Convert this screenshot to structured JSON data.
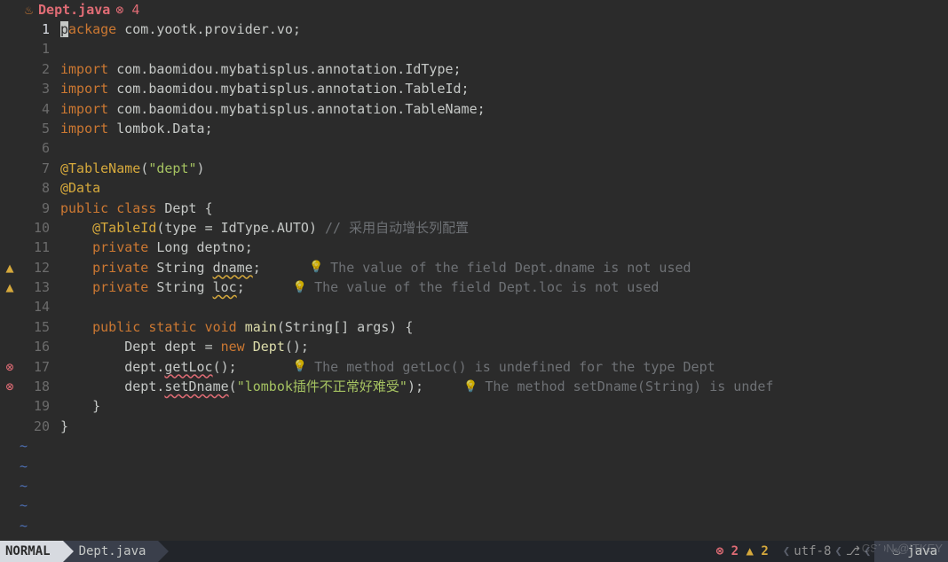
{
  "tab": {
    "icon": "♨",
    "filename": "Dept.java",
    "errorBadge": "⊗ 4"
  },
  "lines": [
    {
      "n": "1",
      "gutter": "",
      "gclass": "",
      "lnclass": "current",
      "tokens": [
        [
          "cursor",
          "p"
        ],
        [
          "kw",
          "ackage"
        ],
        [
          "",
          " "
        ],
        [
          "ident",
          "com.yootk.provider.vo"
        ],
        [
          "ident",
          ";"
        ]
      ],
      "hint": ""
    },
    {
      "n": "1",
      "tokens": [],
      "hint": ""
    },
    {
      "n": "2",
      "tokens": [
        [
          "kw",
          "import"
        ],
        [
          "",
          " "
        ],
        [
          "ident",
          "com.baomidou.mybatisplus.annotation.IdType"
        ],
        [
          "ident",
          ";"
        ]
      ],
      "hint": ""
    },
    {
      "n": "3",
      "tokens": [
        [
          "kw",
          "import"
        ],
        [
          "",
          " "
        ],
        [
          "ident",
          "com.baomidou.mybatisplus.annotation.TableId"
        ],
        [
          "ident",
          ";"
        ]
      ],
      "hint": ""
    },
    {
      "n": "4",
      "tokens": [
        [
          "kw",
          "import"
        ],
        [
          "",
          " "
        ],
        [
          "ident",
          "com.baomidou.mybatisplus.annotation.TableName"
        ],
        [
          "ident",
          ";"
        ]
      ],
      "hint": ""
    },
    {
      "n": "5",
      "tokens": [
        [
          "kw",
          "import"
        ],
        [
          "",
          " "
        ],
        [
          "ident",
          "lombok.Data"
        ],
        [
          "ident",
          ";"
        ]
      ],
      "hint": ""
    },
    {
      "n": "6",
      "tokens": [],
      "hint": ""
    },
    {
      "n": "7",
      "tokens": [
        [
          "anno",
          "@TableName"
        ],
        [
          "ident",
          "("
        ],
        [
          "str",
          "\"dept\""
        ],
        [
          "ident",
          ")"
        ]
      ],
      "hint": ""
    },
    {
      "n": "8",
      "tokens": [
        [
          "anno",
          "@Data"
        ]
      ],
      "hint": ""
    },
    {
      "n": "9",
      "tokens": [
        [
          "kw",
          "public"
        ],
        [
          "",
          " "
        ],
        [
          "kw",
          "class"
        ],
        [
          "",
          " "
        ],
        [
          "ident",
          "Dept "
        ],
        [
          "ident",
          "{"
        ]
      ],
      "hint": ""
    },
    {
      "n": "10",
      "tokens": [
        [
          "",
          "    "
        ],
        [
          "anno",
          "@TableId"
        ],
        [
          "ident",
          "("
        ],
        [
          "ident",
          "type "
        ],
        [
          "ident",
          "= "
        ],
        [
          "ident",
          "IdType"
        ],
        [
          "ident",
          "."
        ],
        [
          "ident",
          "AUTO"
        ],
        [
          "ident",
          ") "
        ],
        [
          "comment",
          "// 采用自动增长列配置"
        ]
      ],
      "hint": ""
    },
    {
      "n": "11",
      "tokens": [
        [
          "",
          "    "
        ],
        [
          "kw",
          "private"
        ],
        [
          "",
          " "
        ],
        [
          "ident",
          "Long "
        ],
        [
          "ident",
          "deptno"
        ],
        [
          "ident",
          ";"
        ]
      ],
      "hint": ""
    },
    {
      "n": "12",
      "gutter": "▲",
      "gclass": "g-warn",
      "tokens": [
        [
          "",
          "    "
        ],
        [
          "kw",
          "private"
        ],
        [
          "",
          " "
        ],
        [
          "ident",
          "String "
        ],
        [
          "warnul",
          "dname"
        ],
        [
          "ident",
          ";"
        ]
      ],
      "hintPad": "      ",
      "hint": "The value of the field Dept.dname is not used"
    },
    {
      "n": "13",
      "gutter": "▲",
      "gclass": "g-warn",
      "tokens": [
        [
          "",
          "    "
        ],
        [
          "kw",
          "private"
        ],
        [
          "",
          " "
        ],
        [
          "ident",
          "String "
        ],
        [
          "warnul",
          "loc"
        ],
        [
          "ident",
          ";"
        ]
      ],
      "hintPad": "      ",
      "hint": "The value of the field Dept.loc is not used"
    },
    {
      "n": "14",
      "tokens": [],
      "hint": ""
    },
    {
      "n": "15",
      "tokens": [
        [
          "",
          "    "
        ],
        [
          "kw",
          "public"
        ],
        [
          "",
          " "
        ],
        [
          "kw",
          "static"
        ],
        [
          "",
          " "
        ],
        [
          "kw",
          "void"
        ],
        [
          "",
          " "
        ],
        [
          "method",
          "main"
        ],
        [
          "ident",
          "("
        ],
        [
          "ident",
          "String"
        ],
        [
          "ident",
          "[] "
        ],
        [
          "ident",
          "args"
        ],
        [
          "ident",
          ") {"
        ]
      ],
      "hint": ""
    },
    {
      "n": "16",
      "tokens": [
        [
          "",
          "        "
        ],
        [
          "ident",
          "Dept "
        ],
        [
          "ident",
          "dept "
        ],
        [
          "ident",
          "= "
        ],
        [
          "kw",
          "new"
        ],
        [
          "",
          " "
        ],
        [
          "method",
          "Dept"
        ],
        [
          "ident",
          "();"
        ]
      ],
      "hint": ""
    },
    {
      "n": "17",
      "gutter": "⊗",
      "gclass": "g-err",
      "tokens": [
        [
          "",
          "        "
        ],
        [
          "ident",
          "dept."
        ],
        [
          "errul",
          "getLoc"
        ],
        [
          "ident",
          "();"
        ]
      ],
      "hintPad": "       ",
      "hint": "The method getLoc() is undefined for the type Dept"
    },
    {
      "n": "18",
      "gutter": "⊗",
      "gclass": "g-err",
      "tokens": [
        [
          "",
          "        "
        ],
        [
          "ident",
          "dept."
        ],
        [
          "errul",
          "setDname"
        ],
        [
          "ident",
          "("
        ],
        [
          "str",
          "\"lombok插件不正常好难受\""
        ],
        [
          "ident",
          ");"
        ]
      ],
      "hintPad": "     ",
      "hint": "The method setDname(String) is undef"
    },
    {
      "n": "19",
      "tokens": [
        [
          "",
          "    "
        ],
        [
          "ident",
          "}"
        ]
      ],
      "hint": ""
    },
    {
      "n": "20",
      "tokens": [
        [
          "ident",
          "}"
        ]
      ],
      "hint": ""
    }
  ],
  "tildes": 5,
  "status": {
    "mode": "NORMAL",
    "filename": "Dept.java",
    "errors": "⊗ 2",
    "warnings": "▲ 2",
    "encoding": "utf-8",
    "branchIcon": "⎇",
    "filetype": "java",
    "filetypeIcon": "♨"
  },
  "watermark": "CSDN @ITKEY"
}
